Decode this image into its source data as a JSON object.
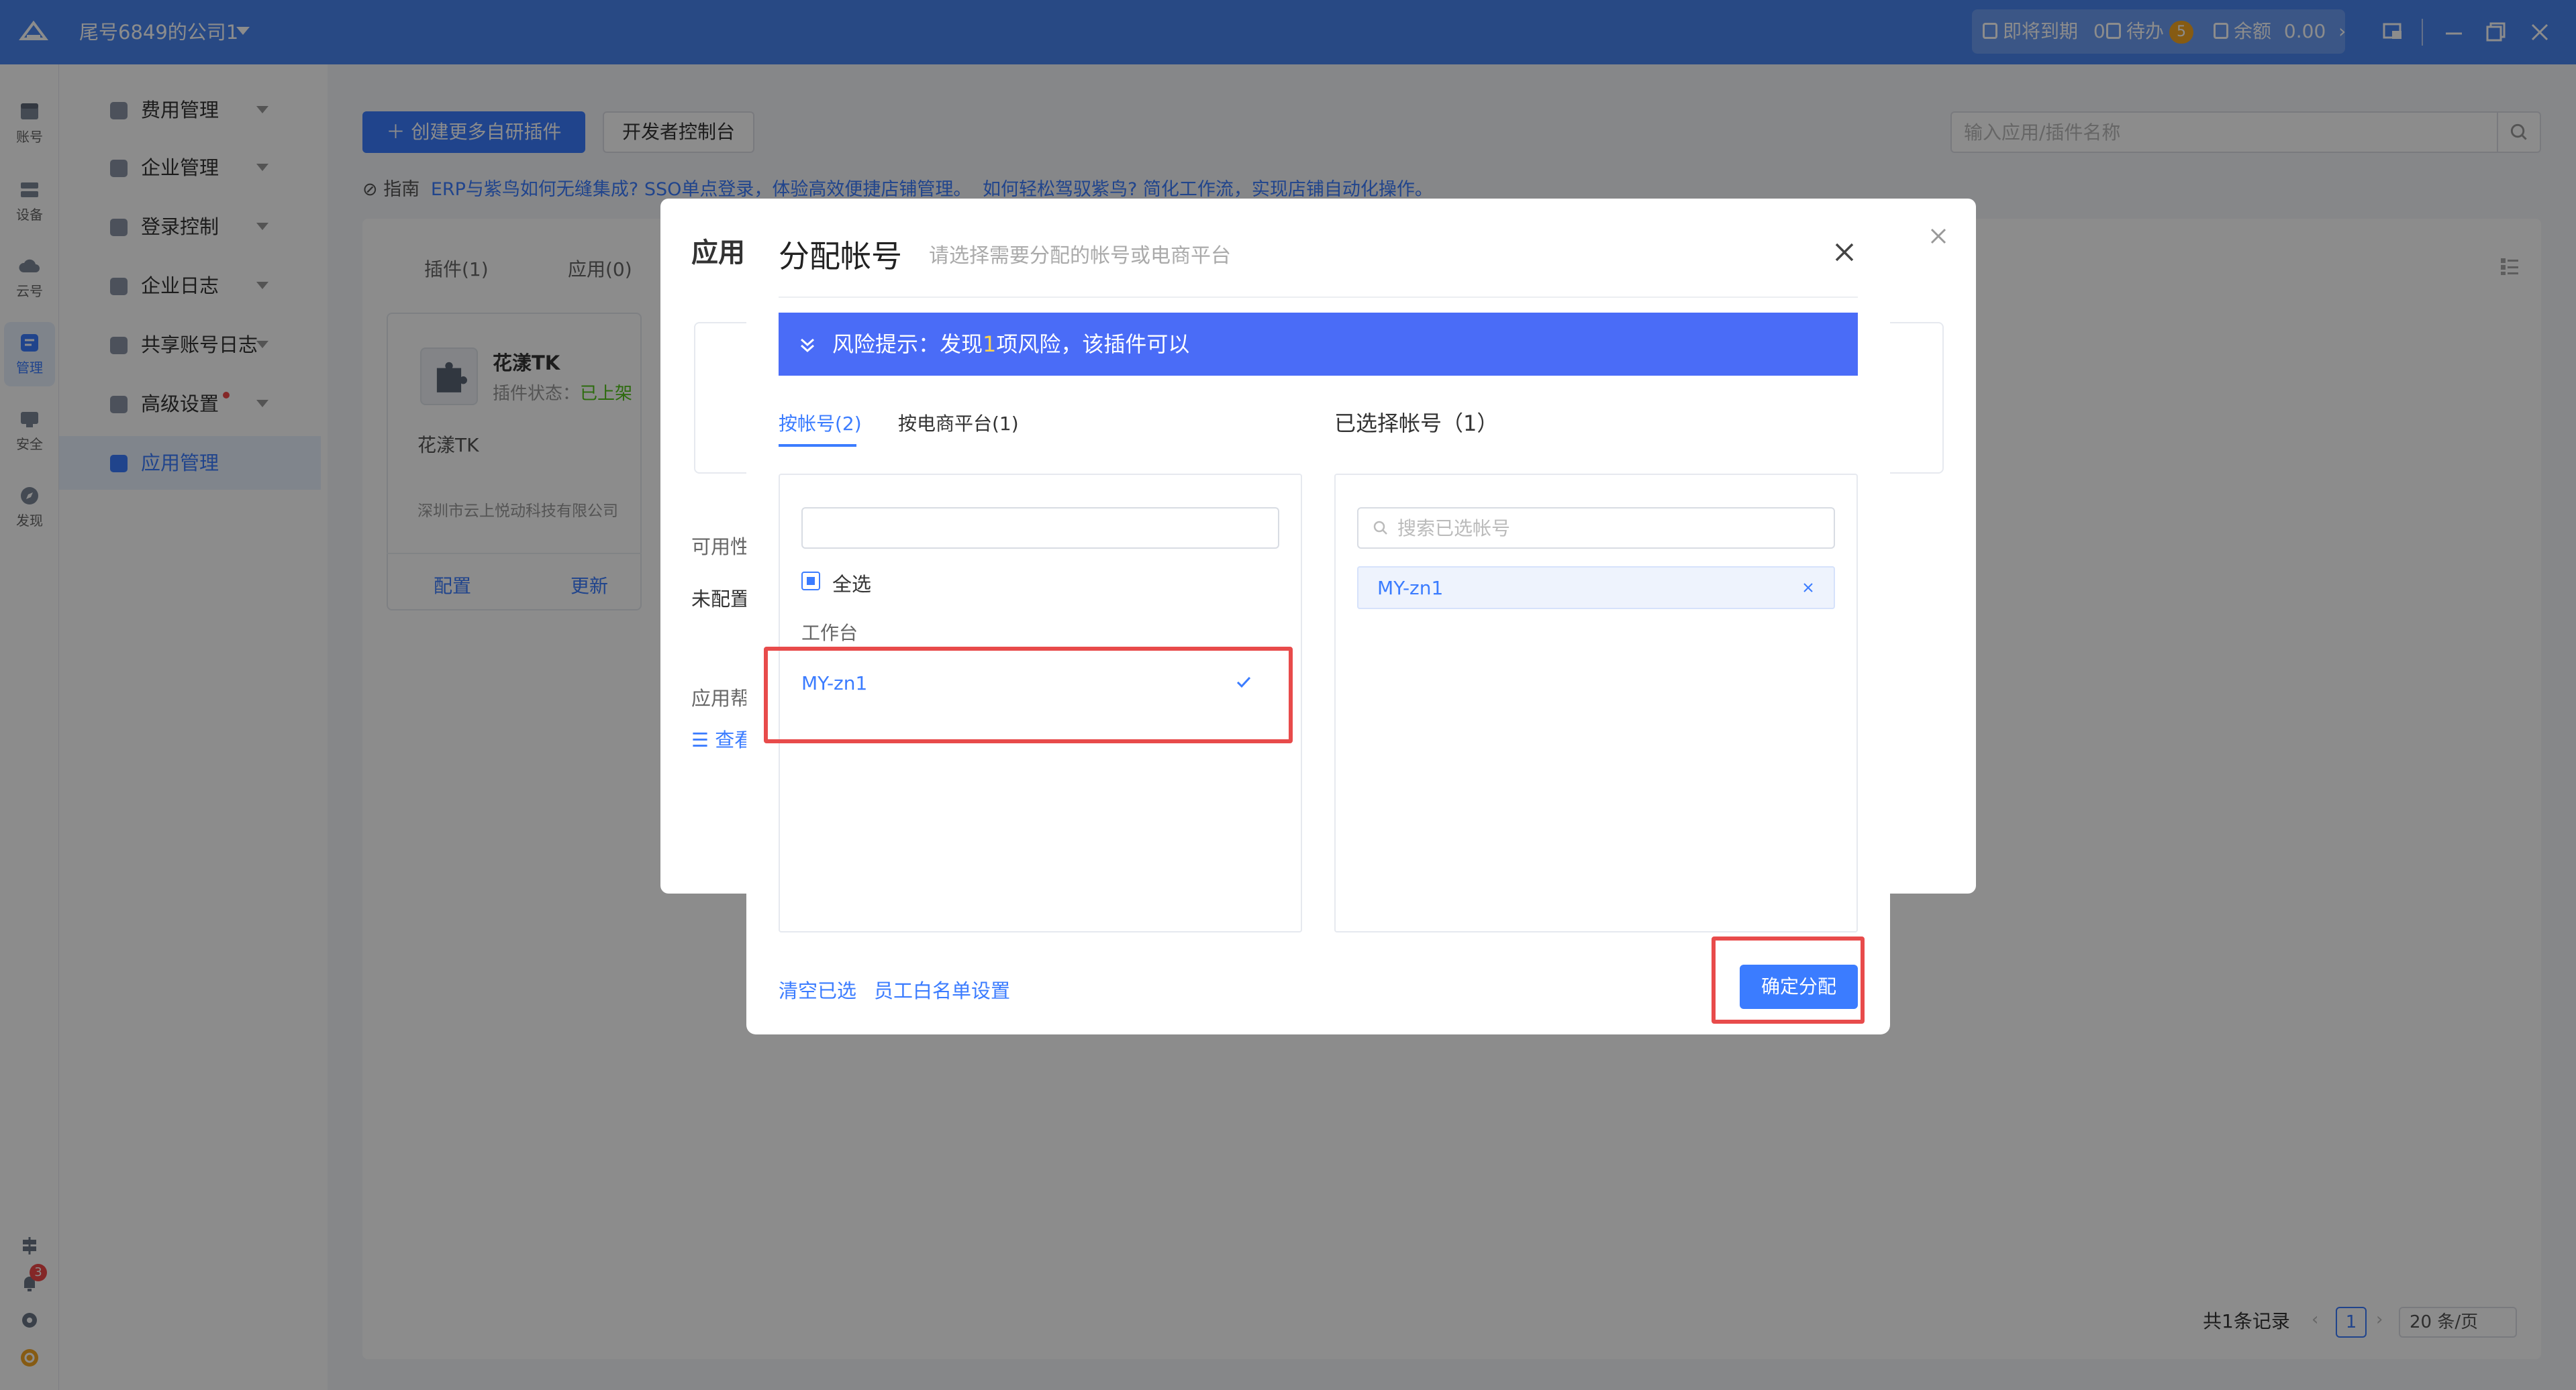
{
  "topbar": {
    "company": "尾号6849的公司1",
    "expiring_label": "即将到期",
    "expiring_count": "0",
    "todo_label": "待办",
    "todo_count": "5",
    "balance_label": "余额",
    "balance_value": "0.00"
  },
  "rail": {
    "items": [
      {
        "label": "账号",
        "icon": "store-icon"
      },
      {
        "label": "设备",
        "icon": "server-icon"
      },
      {
        "label": "云号",
        "icon": "cloud-icon"
      },
      {
        "label": "管理",
        "icon": "manage-icon"
      },
      {
        "label": "安全",
        "icon": "shield-icon"
      },
      {
        "label": "发现",
        "icon": "compass-icon"
      }
    ],
    "notification_count": "3"
  },
  "sidebar": {
    "items": [
      {
        "label": "费用管理"
      },
      {
        "label": "企业管理"
      },
      {
        "label": "登录控制"
      },
      {
        "label": "企业日志"
      },
      {
        "label": "共享账号日志"
      },
      {
        "label": "高级设置"
      },
      {
        "label": "应用管理"
      }
    ]
  },
  "main": {
    "create_button": "创建更多自研插件",
    "dev_console_button": "开发者控制台",
    "search_placeholder": "输入应用/插件名称",
    "guide_prefix": "指南",
    "guide_text": "ERP与紫鸟如何无缝集成? SSO单点登录，体验高效便捷店铺管理。",
    "guide_link": "如何轻松驾驭紫鸟? 简化工作流，实现店铺自动化操作。",
    "tabs": [
      "插件(1)",
      "应用(0)"
    ],
    "plugin": {
      "name": "花漾TK",
      "status_label": "插件状态：",
      "status_value": "已上架",
      "description": "花漾TK",
      "vendor": "深圳市云上悦动科技有限公司",
      "configure": "配置",
      "update": "更新"
    },
    "pagination": {
      "total": "共1条记录",
      "page": "1",
      "page_size": "20 条/页"
    }
  },
  "bg_modal": {
    "title": "应用",
    "label_availability": "可用性",
    "value_availability": "未配置",
    "label_help": "应用帮",
    "link_view": "查看"
  },
  "modal": {
    "title": "分配帐号",
    "subtitle": "请选择需要分配的帐号或电商平台",
    "risk_prefix": "风险提示：发现",
    "risk_count": "1",
    "risk_suffix": "项风险，该插件可以",
    "tab_account": "按帐号(2)",
    "tab_platform": "按电商平台(1)",
    "selected_title": "已选择帐号（1）",
    "left_search_value": "",
    "select_all": "全选",
    "group": "工作台",
    "account": "MY-zn1",
    "right_search_placeholder": "搜索已选帐号",
    "selected_chip": "MY-zn1",
    "clear_link": "清空已选",
    "whitelist_link": "员工白名单设置",
    "confirm_button": "确定分配"
  },
  "colors": {
    "accent": "#3b7cff",
    "topbar": "#4a86f0",
    "risk_banner": "#4a6cf7",
    "highlight": "#e84b4b"
  }
}
